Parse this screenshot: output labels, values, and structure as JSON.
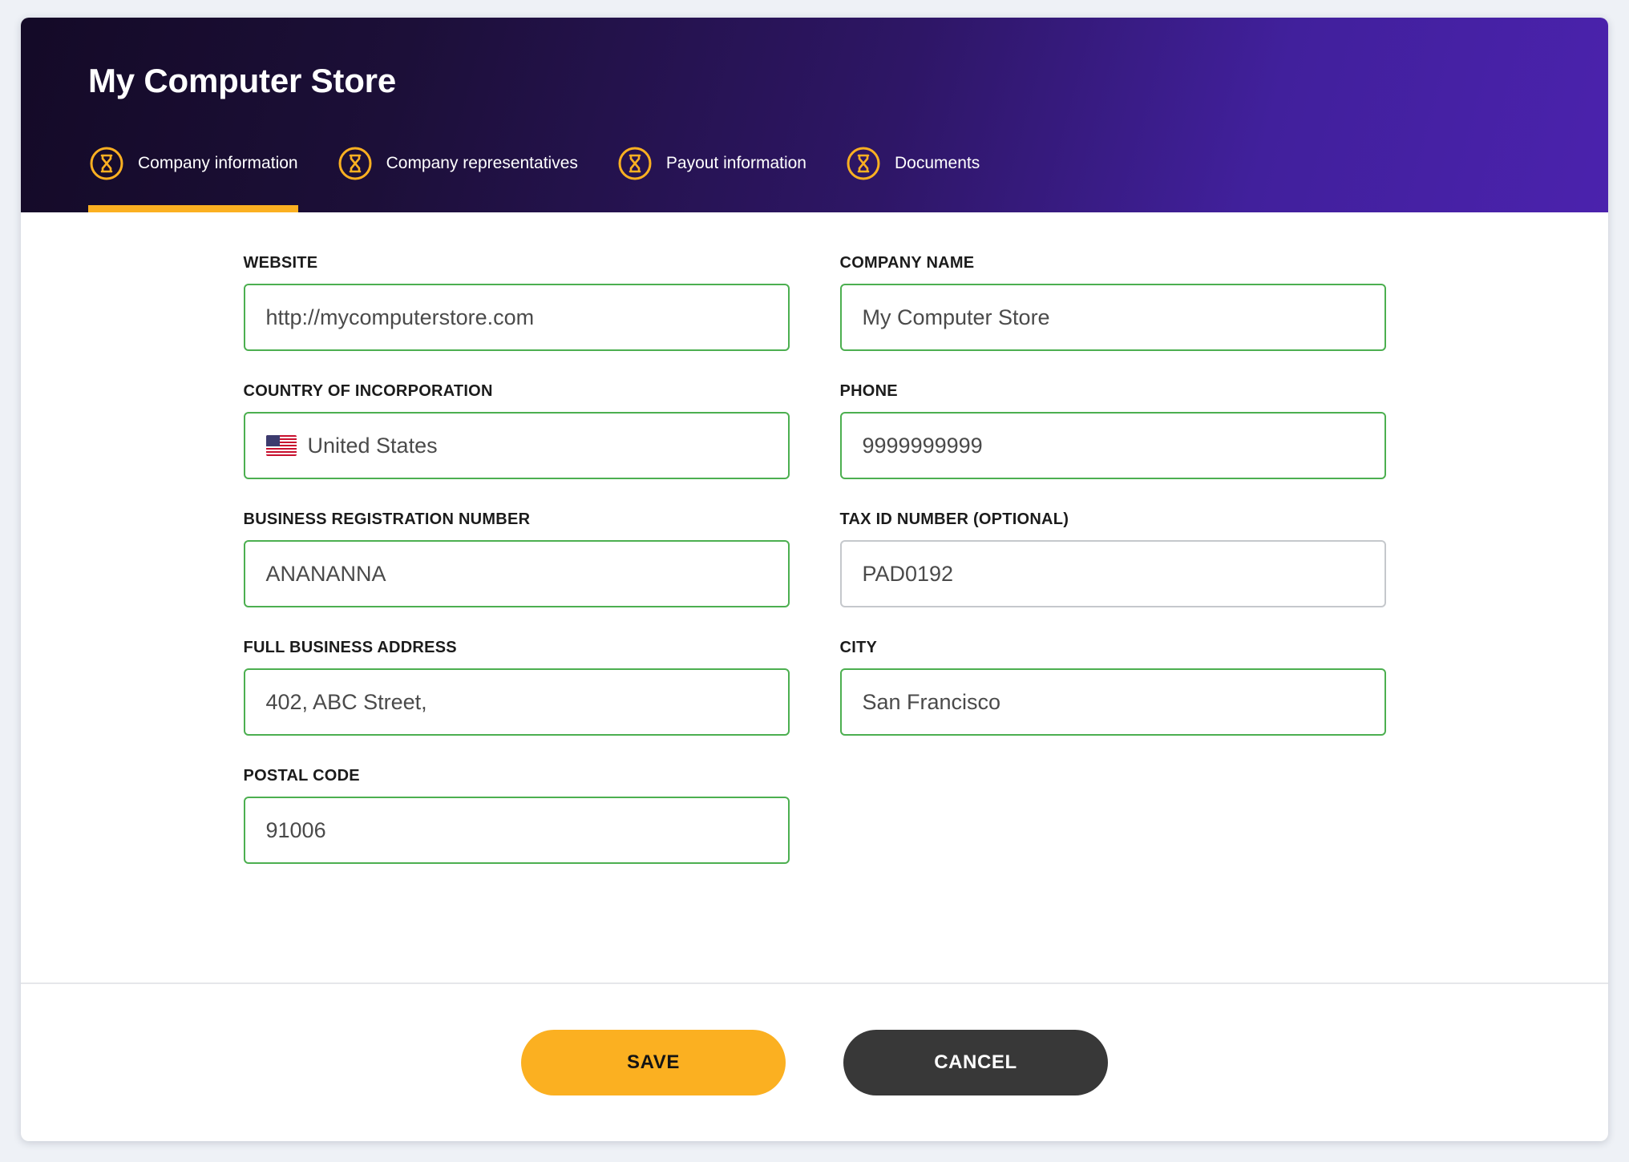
{
  "header": {
    "title": "My Computer Store",
    "accent_color": "#fbb021",
    "gradient_from": "#140a27",
    "gradient_to": "#4b22ad",
    "tabs": [
      {
        "label": "Company information",
        "icon": "hourglass-circle-icon",
        "active": true
      },
      {
        "label": "Company representatives",
        "icon": "hourglass-circle-icon",
        "active": false
      },
      {
        "label": "Payout information",
        "icon": "hourglass-circle-icon",
        "active": false
      },
      {
        "label": "Documents",
        "icon": "hourglass-circle-icon",
        "active": false
      }
    ]
  },
  "form": {
    "valid_border_color": "#4caf50",
    "neutral_border_color": "#c5c8cc",
    "fields": {
      "website": {
        "label": "WEBSITE",
        "value": "http://mycomputerstore.com",
        "state": "valid"
      },
      "company_name": {
        "label": "COMPANY NAME",
        "value": "My Computer Store",
        "state": "valid"
      },
      "country": {
        "label": "COUNTRY OF INCORPORATION",
        "value": "United States",
        "state": "valid",
        "flag": "us-flag-icon"
      },
      "phone": {
        "label": "PHONE",
        "value": "9999999999",
        "state": "valid"
      },
      "business_reg": {
        "label": "BUSINESS REGISTRATION NUMBER",
        "value": "ANANANNA",
        "state": "valid"
      },
      "tax_id": {
        "label": "TAX ID NUMBER (OPTIONAL)",
        "value": "PAD0192",
        "state": "neutral"
      },
      "address": {
        "label": "FULL BUSINESS ADDRESS",
        "value": "402, ABC Street,",
        "state": "valid"
      },
      "city": {
        "label": "CITY",
        "value": "San Francisco",
        "state": "valid"
      },
      "postal_code": {
        "label": "POSTAL CODE",
        "value": "91006",
        "state": "valid"
      }
    }
  },
  "footer": {
    "save_label": "SAVE",
    "cancel_label": "CANCEL",
    "save_color": "#fbb021",
    "cancel_color": "#383838"
  }
}
